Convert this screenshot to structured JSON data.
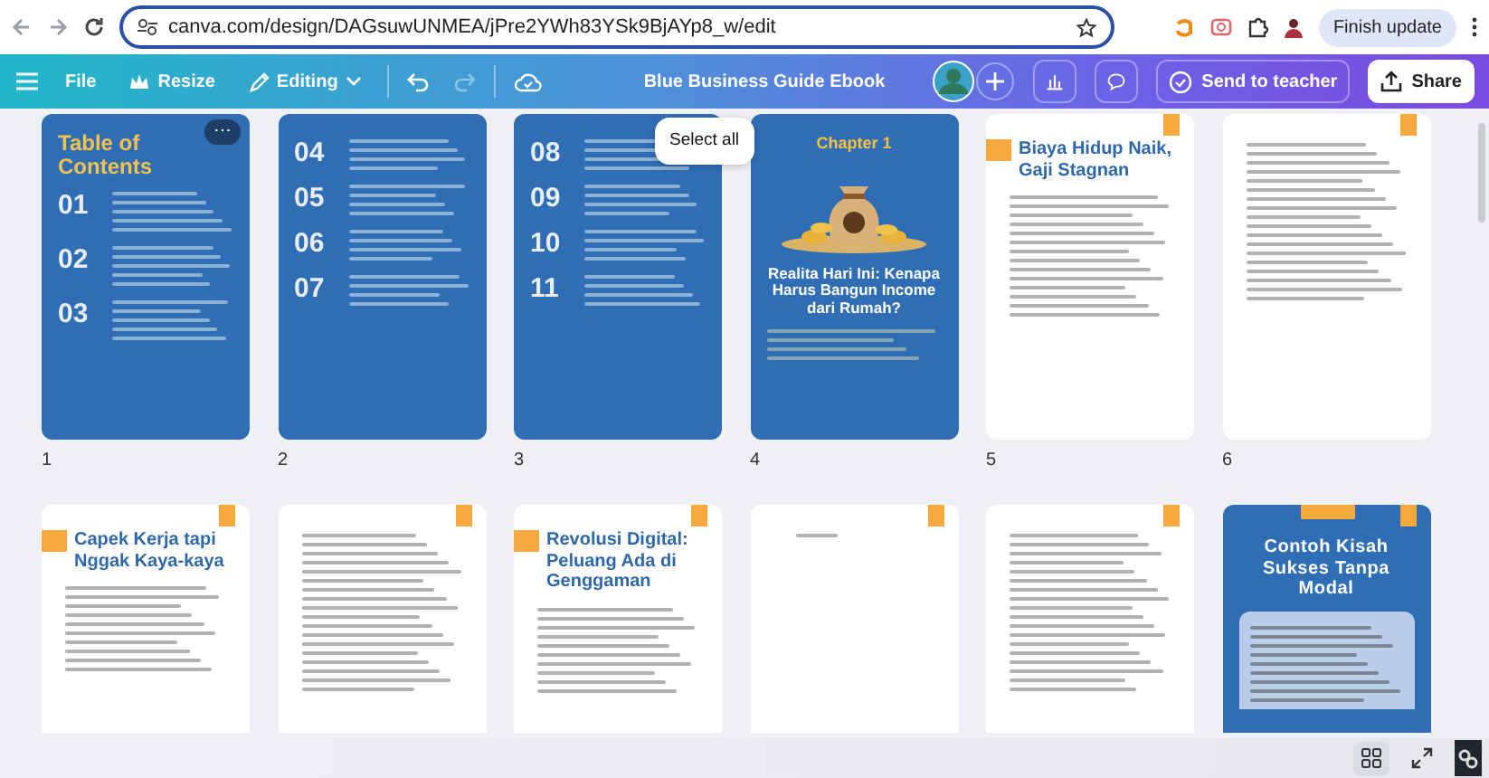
{
  "browser": {
    "url": "canva.com/design/DAGsuwUNMEA/jPre2YWh83YSk9BjAYp8_w/edit",
    "update_button": "Finish update"
  },
  "toolbar": {
    "menu": [
      "File",
      "Resize",
      "Editing"
    ],
    "history": [
      {
        "kind": "undo",
        "disabled": false
      },
      {
        "kind": "redo",
        "disabled": true
      }
    ],
    "title": "Blue Business Guide Ebook",
    "send_button": "Send to teacher",
    "share_button": "Share"
  },
  "tooltip": "Select all",
  "pages": [
    {
      "kind": "toc",
      "number": "1",
      "title": "Table of Contents",
      "sections": [
        "01",
        "02",
        "03"
      ],
      "menu": "⋯"
    },
    {
      "kind": "toc",
      "number": "2",
      "sections": [
        "04",
        "05",
        "06",
        "07"
      ]
    },
    {
      "kind": "toc",
      "number": "3",
      "sections": [
        "08",
        "09",
        "10",
        "11"
      ]
    },
    {
      "kind": "chapter",
      "number": "4",
      "label": "Chapter 1",
      "title": "Realita Hari Ini: Kenapa Harus Bangun Income dari Rumah?"
    },
    {
      "kind": "article",
      "number": "5",
      "title": "Biaya Hidup Naik, Gaji Stagnan"
    },
    {
      "kind": "text",
      "number": "6"
    },
    {
      "kind": "article",
      "title": "Capek Kerja tapi Nggak Kaya-kaya"
    },
    {
      "kind": "text"
    },
    {
      "kind": "article",
      "title": "Revolusi Digital: Peluang Ada di Genggaman"
    },
    {
      "kind": "note"
    },
    {
      "kind": "text"
    },
    {
      "kind": "story",
      "title": "Contoh Kisah Sukses Tanpa Modal"
    }
  ],
  "view_buttons": [
    {
      "kind": "grid",
      "selected": true
    },
    {
      "kind": "fullscreen",
      "selected": false
    }
  ]
}
